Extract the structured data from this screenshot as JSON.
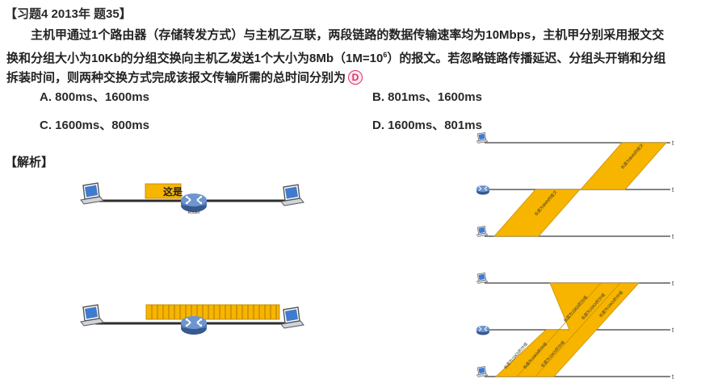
{
  "question": {
    "header": "【习题4  2013年 题35】",
    "stem_part1": "主机甲通过1个路由器（存储转发方式）与主机乙互联，两段链路的数据传输速率均为10Mbps，主机甲分别采用报文交换和分组大小为10Kb的分组交换向主机乙发送1个大小为8Mb（1M=10",
    "stem_sup": "6",
    "stem_part2": "）的报文。若忽略链路传播延迟、分组头开销和分组拆装时间，则两种交换方式完成该报文传输所需的总时间分别为",
    "answer_letter": "D"
  },
  "options": {
    "a": "A. 800ms、1600ms",
    "b": "B. 801ms、1600ms",
    "c": "C. 1600ms、800ms",
    "d": "D. 1600ms、801ms"
  },
  "analysis": {
    "label": "【解析】",
    "message_box_text": "这是",
    "router_label": "Router",
    "time_axis_label": "t",
    "msg_band_text": "长度为8Mb的报文",
    "pkt_band_text": "长度为10Kb的分组"
  },
  "colors": {
    "band_fill": "#f7b500",
    "band_stroke": "#c98f00",
    "link": "#2d2d2d",
    "timeline": "#3a3a3a",
    "laptop_blue": "#3f7bd0",
    "router_blue": "#4d74ad",
    "answer_pink": "#e0306a"
  }
}
